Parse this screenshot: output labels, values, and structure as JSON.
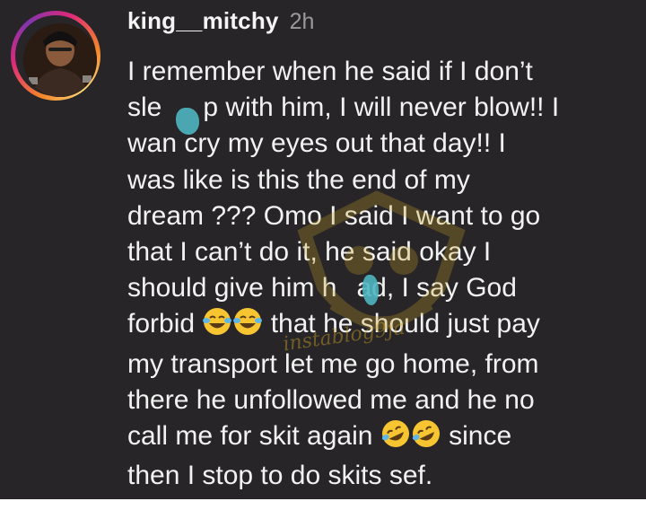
{
  "comment": {
    "username": "king__mitchy",
    "timestamp": "2h",
    "lines": [
      "I remember when he said if I don’t",
      "sle",
      "p with him, I will never blow!! I",
      "wan cry my eyes out that day!! I",
      "was like is this the end of my",
      "dream ??? Omo I said I want to go",
      "that I can’t do it, he said okay I",
      "should give him h",
      "ad, I say God",
      "forbid",
      " that he should just pay",
      "my transport let me go home, from",
      "there he unfollowed me and he no",
      "call me for skit again",
      " since",
      "then I stop to do skits sef."
    ]
  },
  "watermark": {
    "text": "instablog9ja"
  },
  "icons": {
    "laugh_emoji": "face-with-tears-of-joy-icon",
    "rofl_emoji": "rolling-on-floor-laughing-icon"
  },
  "colors": {
    "background": "#272527",
    "text": "#f2f2f2",
    "timestamp": "#9a9a9a",
    "emoji": "#f6c531",
    "censor": "#4fb6c2",
    "watermark": "#c9a227"
  }
}
